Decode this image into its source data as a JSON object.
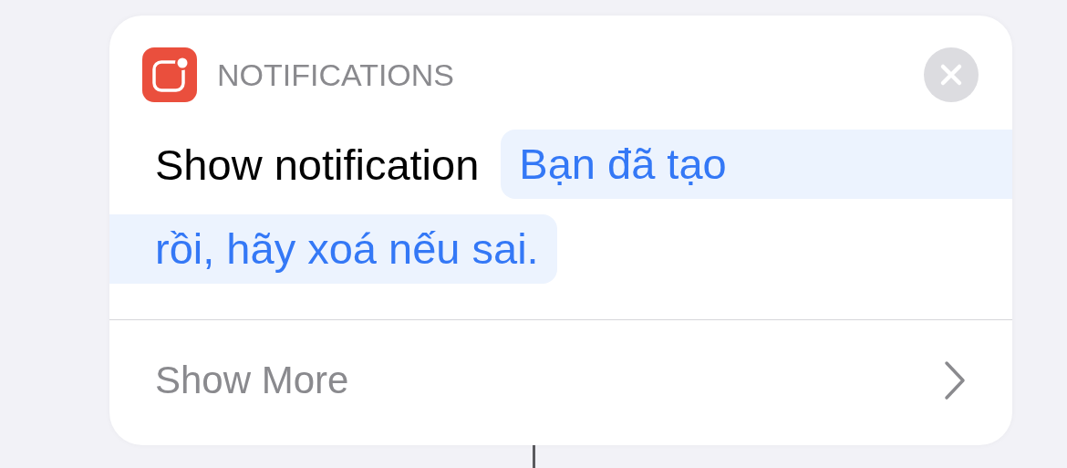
{
  "app": {
    "name": "NOTIFICATIONS"
  },
  "action": {
    "label": "Show notification",
    "token_lines": [
      "Bạn đã tạo",
      "rồi, hãy xoá nếu sai."
    ]
  },
  "footer": {
    "label": "Show More"
  }
}
